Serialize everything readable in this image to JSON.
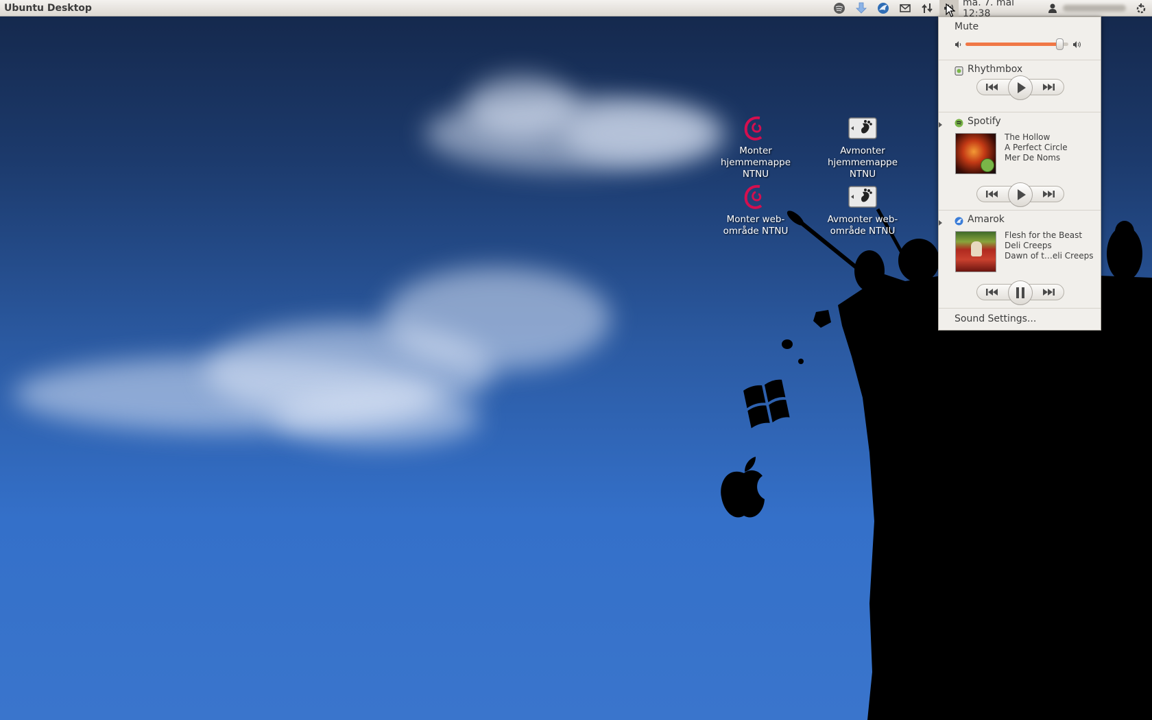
{
  "panel": {
    "app_title": "Ubuntu Desktop",
    "clock": "ma. 7. mai 12:38",
    "tray_icons": [
      "spotify-tray-icon",
      "download-arrow-icon",
      "thunderbird-icon",
      "mail-icon",
      "network-arrows-icon",
      "volume-icon",
      "user-icon",
      "session-gear-icon"
    ]
  },
  "desktop_icons": [
    {
      "name": "monter-hjemmemappe",
      "line1": "Monter",
      "line2": "hjemmemappe",
      "line3": "NTNU",
      "icon": "debian-swirl-icon"
    },
    {
      "name": "avmonter-hjemmemappe",
      "line1": "Avmonter",
      "line2": "hjemmemappe",
      "line3": "NTNU",
      "icon": "gnome-foot-icon"
    },
    {
      "name": "monter-webomrade",
      "line1": "Monter web-",
      "line2": "område NTNU",
      "line3": "",
      "icon": "debian-swirl-icon"
    },
    {
      "name": "avmonter-webomrade",
      "line1": "Avmonter web-",
      "line2": "område NTNU",
      "line3": "",
      "icon": "gnome-foot-icon"
    }
  ],
  "sound_menu": {
    "mute_label": "Mute",
    "volume_level": 0.95,
    "accent": "#f07746",
    "players": [
      {
        "name": "Rhythmbox",
        "tracks": [],
        "state": "play"
      },
      {
        "name": "Spotify",
        "tracks": [
          "The Hollow",
          "A Perfect Circle",
          "Mer De Noms"
        ],
        "state": "play"
      },
      {
        "name": "Amarok",
        "tracks": [
          "Flesh for the Beast",
          "Deli Creeps",
          "Dawn of t…eli Creeps"
        ],
        "state": "pause"
      }
    ],
    "settings_label": "Sound Settings..."
  }
}
